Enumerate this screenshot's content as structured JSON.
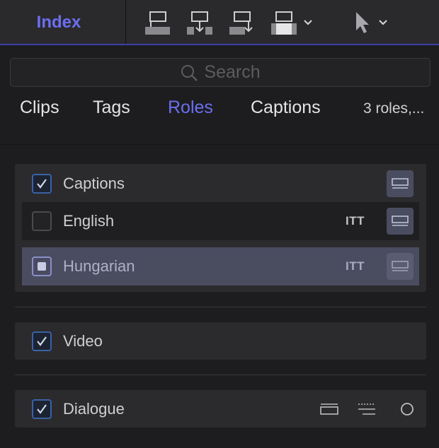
{
  "toolbar": {
    "index_label": "Index",
    "tools": [
      {
        "icon": "connect-clip-icon"
      },
      {
        "icon": "insert-clip-icon"
      },
      {
        "icon": "append-clip-icon"
      },
      {
        "icon": "overwrite-clip-icon",
        "has_menu": true
      },
      {
        "icon": "select-tool-icon",
        "has_menu": true
      }
    ]
  },
  "search": {
    "placeholder": "Search"
  },
  "tabs": [
    {
      "label": "Clips",
      "active": false
    },
    {
      "label": "Tags",
      "active": false
    },
    {
      "label": "Roles",
      "active": true
    },
    {
      "label": "Captions",
      "active": false
    }
  ],
  "tab_count": "3 roles,...",
  "roles": {
    "captions": {
      "label": "Captions",
      "checked": true,
      "subroles": [
        {
          "label": "English",
          "format": "ITT",
          "checked": false
        },
        {
          "label": "Hungarian",
          "format": "ITT",
          "state": "partial",
          "selected": true
        }
      ]
    },
    "video": {
      "label": "Video",
      "checked": true
    },
    "dialogue": {
      "label": "Dialogue",
      "checked": true
    }
  },
  "colors": {
    "accent": "#6c6ef2",
    "checkbox_checked": "#3a62a6",
    "selected_row": "#4a4c60"
  }
}
